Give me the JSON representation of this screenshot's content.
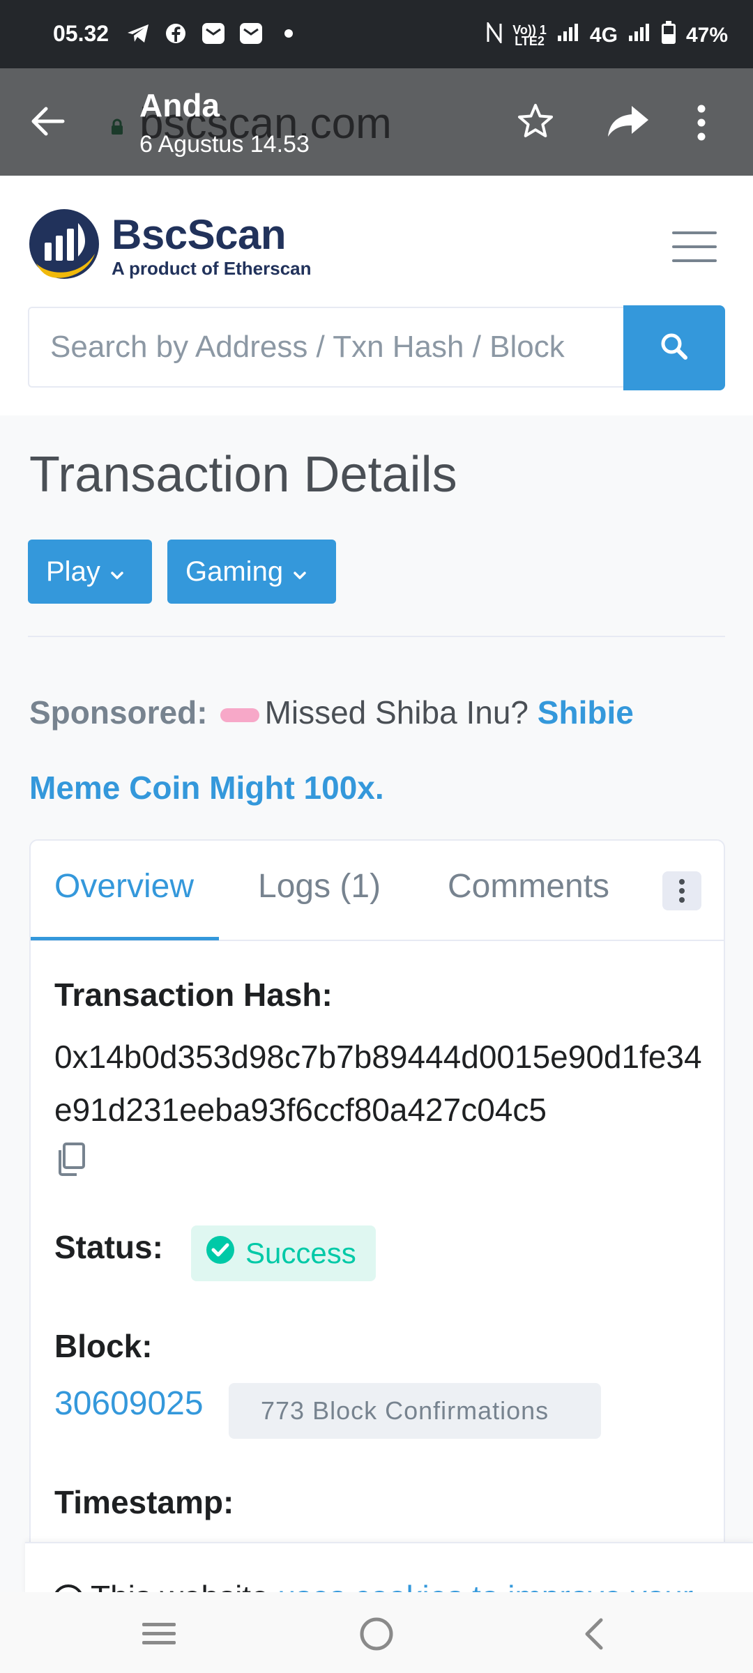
{
  "status_bar": {
    "time": "05.32",
    "network_top": "Vo)) 1",
    "network_bottom": "LTE2",
    "network_type": "4G",
    "battery": "47%",
    "icons": [
      "telegram-icon",
      "facebook-icon",
      "mail-icon",
      "mail-icon",
      "dot-icon",
      "nfc-icon",
      "wifi-icon",
      "signal-icon",
      "battery-icon"
    ]
  },
  "share_header": {
    "name": "Anda",
    "date": "6 Agustus 14.53",
    "underlying_url": "bscscan.com"
  },
  "site": {
    "brand": "BscScan",
    "tagline": "A product of Etherscan",
    "search_placeholder": "Search by Address / Txn Hash / Block"
  },
  "page": {
    "title": "Transaction Details",
    "buttons": [
      "Play",
      "Gaming"
    ]
  },
  "sponsored": {
    "label": "Sponsored:",
    "text": "Missed Shiba Inu?",
    "link": "Shibie Meme Coin Might 100x."
  },
  "tabs": [
    {
      "label": "Overview",
      "active": true
    },
    {
      "label": "Logs (1)",
      "active": false
    },
    {
      "label": "Comments",
      "active": false
    }
  ],
  "transaction": {
    "hash_label": "Transaction Hash:",
    "hash": "0x14b0d353d98c7b7b89444d0015e90d1fe34e91d231eeba93f6ccf80a427c04c5",
    "status_label": "Status:",
    "status": "Success",
    "block_label": "Block:",
    "block": "30609025",
    "confirmations": "773 Block Confirmations",
    "timestamp_label": "Timestamp:"
  },
  "cookie": {
    "text": "This website ",
    "link": "uses cookies to improve your"
  },
  "colors": {
    "accent": "#3498db",
    "success": "#00c9a7",
    "brand": "#21325b"
  }
}
